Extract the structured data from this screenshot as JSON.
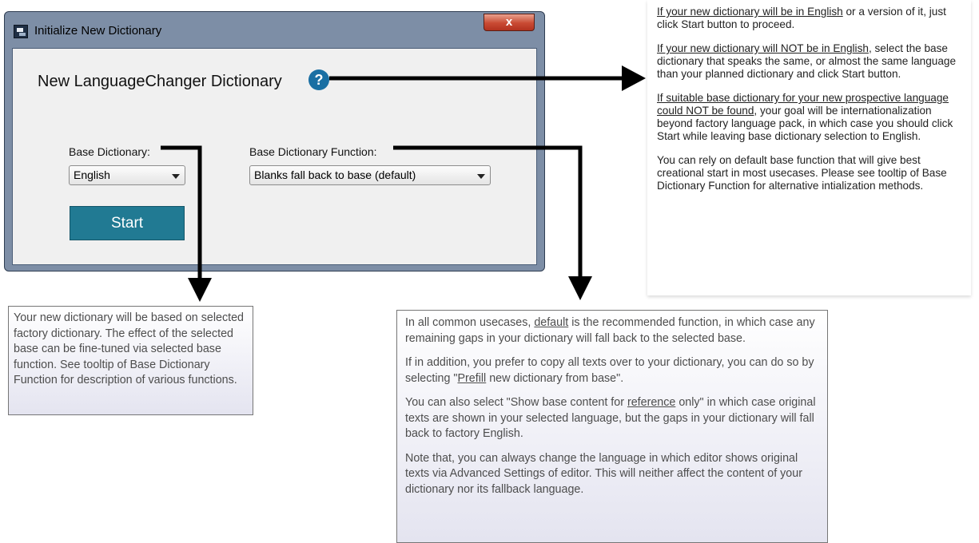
{
  "dialog": {
    "title": "Initialize New Dictionary",
    "close_label": "x",
    "heading": "New LanguageChanger Dictionary",
    "help_label": "?",
    "base_dictionary_label": "Base Dictionary:",
    "base_dictionary_value": "English",
    "base_function_label": "Base Dictionary Function:",
    "base_function_value": "Blanks fall back to base (default)",
    "start_label": "Start"
  },
  "help_note": {
    "p1_underlined": "If your new dictionary will be in English",
    "p1_rest": " or a version of it, just click Start button to proceed.",
    "p2_underlined": "If your new dictionary will NOT be in English",
    "p2_rest": ", select the base dictionary that speaks the same, or almost the same language than your planned dictionary and click Start button.",
    "p3_underlined": "If suitable base dictionary for your new prospective language could NOT be found",
    "p3_rest": ", your goal will be internationalization beyond factory language pack, in which case you should click Start while leaving base dictionary selection to English.",
    "p4": "You can rely on default base function that will give best creational start in most usecases. Please see tooltip of Base Dictionary Function for alternative intialization methods."
  },
  "base_dictionary_tooltip": {
    "text": "Your new dictionary will be based on selected factory dictionary. The effect of the selected base can be fine-tuned via selected base function. See tooltip of Base Dictionary Function for description of various functions."
  },
  "base_function_tooltip": {
    "p1_before": "In all common usecases, ",
    "p1_underlined": "default",
    "p1_after": " is the recommended function, in which case any remaining gaps in your dictionary will fall back to the selected base.",
    "p2_before": "If in addition, you prefer to copy all texts over to your dictionary, you can do so by selecting \"",
    "p2_underlined": "Prefill",
    "p2_after": " new dictionary from base\".",
    "p3_before": "You can also select \"Show base content for ",
    "p3_underlined": "reference",
    "p3_after": " only\" in which case original texts are shown in your selected language, but the gaps in your dictionary will fall back to factory English.",
    "p4": "Note that, you can always change the language in which editor shows original texts via Advanced Settings of editor. This will neither affect the content of your dictionary nor its fallback language."
  },
  "colors": {
    "start_button": "#217a93",
    "help_icon": "#1a6fa3",
    "window_frame": "#7d8ea6",
    "close_button": "#c94a33"
  }
}
